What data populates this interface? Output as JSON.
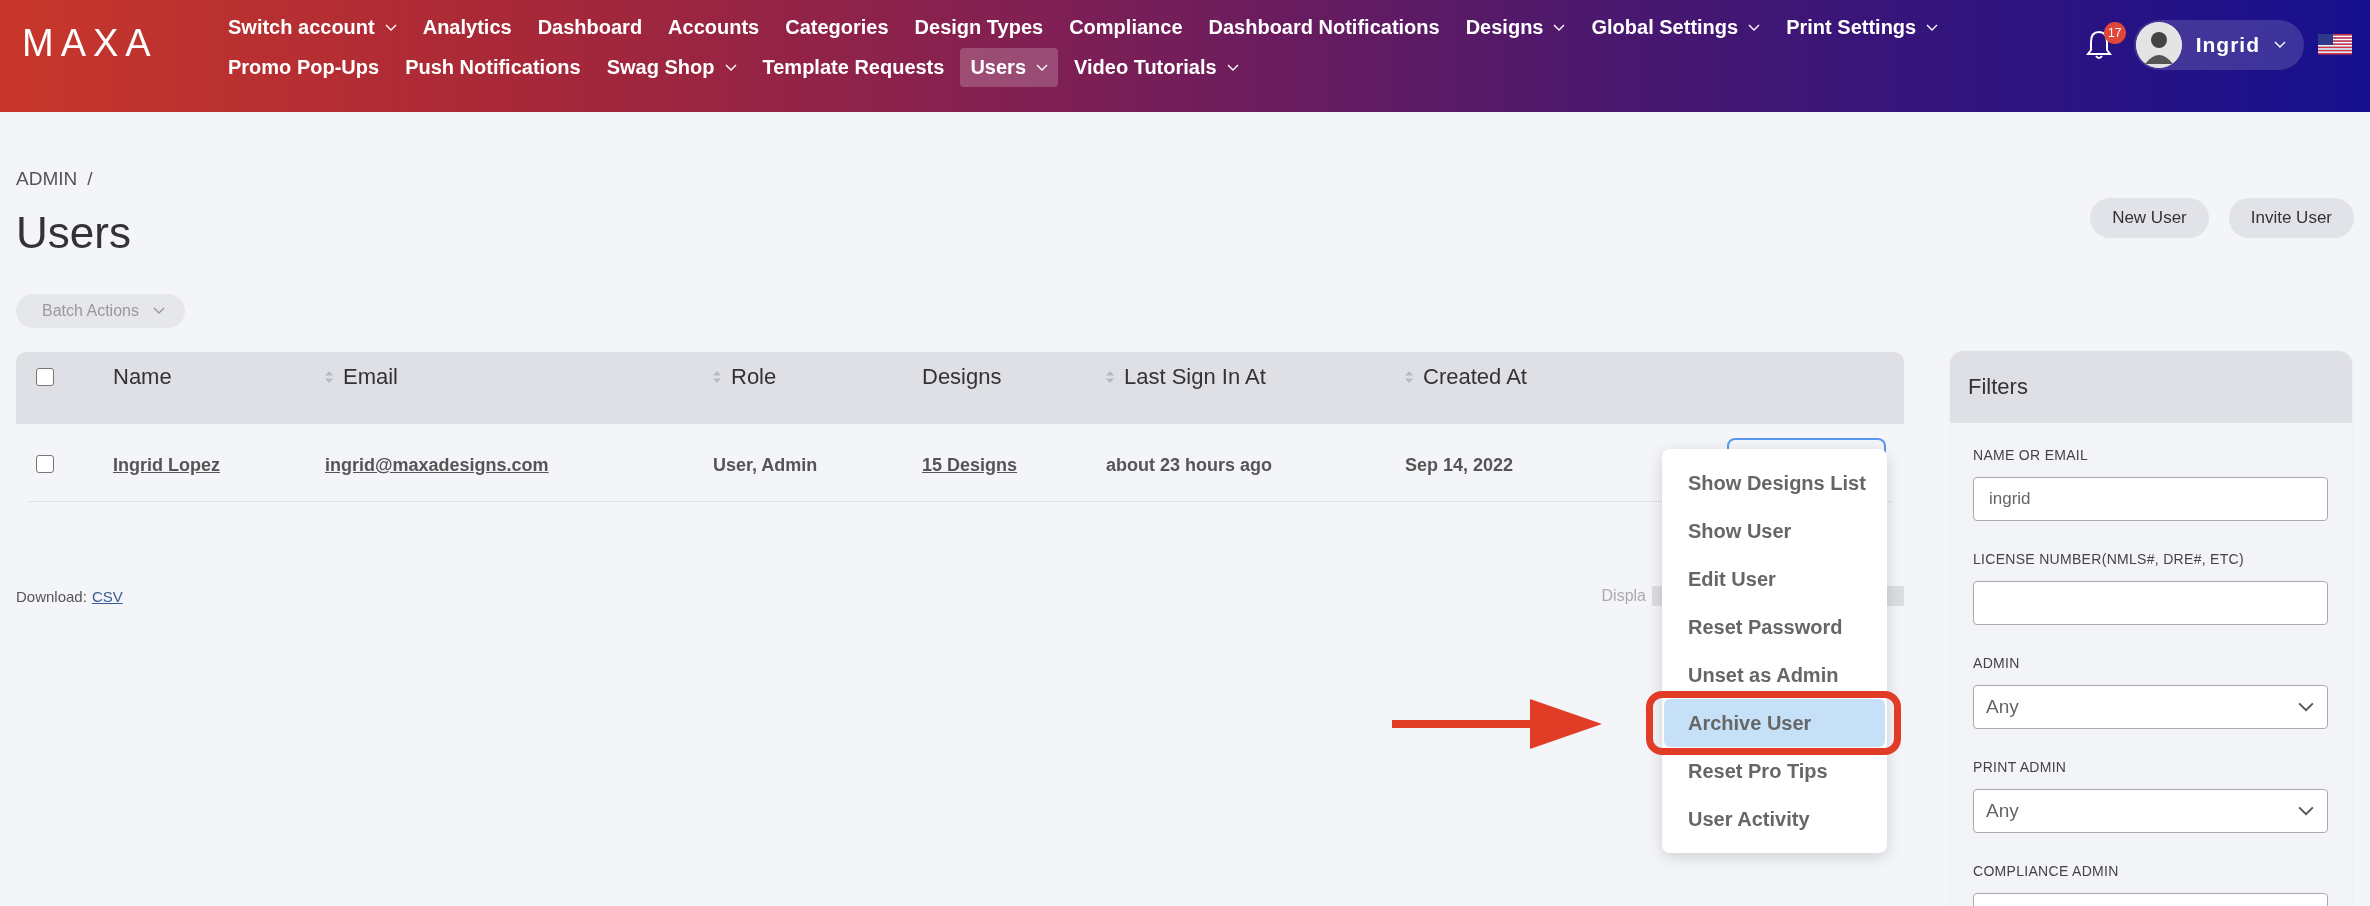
{
  "header": {
    "logo": "MAXA",
    "nav_rows": [
      [
        {
          "label": "Switch account",
          "has_menu": true,
          "selected": false
        },
        {
          "label": "Analytics",
          "has_menu": false,
          "selected": false
        },
        {
          "label": "Dashboard",
          "has_menu": false,
          "selected": false
        },
        {
          "label": "Accounts",
          "has_menu": false,
          "selected": false
        },
        {
          "label": "Categories",
          "has_menu": false,
          "selected": false
        },
        {
          "label": "Design Types",
          "has_menu": false,
          "selected": false
        },
        {
          "label": "Compliance",
          "has_menu": false,
          "selected": false
        },
        {
          "label": "Dashboard Notifications",
          "has_menu": false,
          "selected": false
        },
        {
          "label": "Designs",
          "has_menu": true,
          "selected": false
        },
        {
          "label": "Global Settings",
          "has_menu": true,
          "selected": false
        },
        {
          "label": "Print Settings",
          "has_menu": true,
          "selected": false
        }
      ],
      [
        {
          "label": "Promo Pop-Ups",
          "has_menu": false,
          "selected": false
        },
        {
          "label": "Push Notifications",
          "has_menu": false,
          "selected": false
        },
        {
          "label": "Swag Shop",
          "has_menu": true,
          "selected": false
        },
        {
          "label": "Template Requests",
          "has_menu": false,
          "selected": false
        },
        {
          "label": "Users",
          "has_menu": true,
          "selected": true
        },
        {
          "label": "Video Tutorials",
          "has_menu": true,
          "selected": false
        }
      ]
    ],
    "notification_count": "17",
    "user_name": "Ingrid"
  },
  "breadcrumb": {
    "items": [
      "ADMIN"
    ],
    "separator": "/"
  },
  "page_title": "Users",
  "page_buttons": [
    "New User",
    "Invite User"
  ],
  "batch_actions": "Batch Actions",
  "table": {
    "columns": [
      {
        "label": "Name",
        "sortable": false
      },
      {
        "label": "Email",
        "sortable": true
      },
      {
        "label": "Role",
        "sortable": true
      },
      {
        "label": "Designs",
        "sortable": false
      },
      {
        "label": "Last Sign In At",
        "sortable": true
      },
      {
        "label": "Created At",
        "sortable": true
      }
    ],
    "header_checked": false,
    "rows": [
      {
        "checked": false,
        "cells": [
          {
            "text": "Ingrid Lopez",
            "link": true
          },
          {
            "text": "ingrid@maxadesigns.com",
            "link": true
          },
          {
            "text": "User, Admin",
            "link": false
          },
          {
            "text": "15 Designs",
            "link": true
          },
          {
            "text": "about 23 hours ago",
            "link": false
          },
          {
            "text": "Sep 14, 2022",
            "link": false
          }
        ]
      }
    ]
  },
  "action_menu": {
    "items": [
      {
        "label": "Show Designs List",
        "selected": false
      },
      {
        "label": "Show User",
        "selected": false
      },
      {
        "label": "Edit User",
        "selected": false
      },
      {
        "label": "Reset Password",
        "selected": false
      },
      {
        "label": "Unset as Admin",
        "selected": false
      },
      {
        "label": "Archive User",
        "selected": true
      },
      {
        "label": "Reset Pro Tips",
        "selected": false
      },
      {
        "label": "User Activity",
        "selected": false
      }
    ]
  },
  "footer": {
    "download_label": "Download:",
    "download_link": "CSV",
    "display_text": "Displa"
  },
  "filters": {
    "title": "Filters",
    "fields": [
      {
        "label": "NAME OR EMAIL",
        "kind": "text",
        "value": "ingrid"
      },
      {
        "label": "LICENSE NUMBER(NMLS#, DRE#, ETC)",
        "kind": "text"
      },
      {
        "label": "ADMIN",
        "kind": "select",
        "value": "Any"
      },
      {
        "label": "PRINT ADMIN",
        "kind": "select",
        "value": "Any"
      },
      {
        "label": "COMPLIANCE ADMIN",
        "kind": "select"
      }
    ]
  }
}
